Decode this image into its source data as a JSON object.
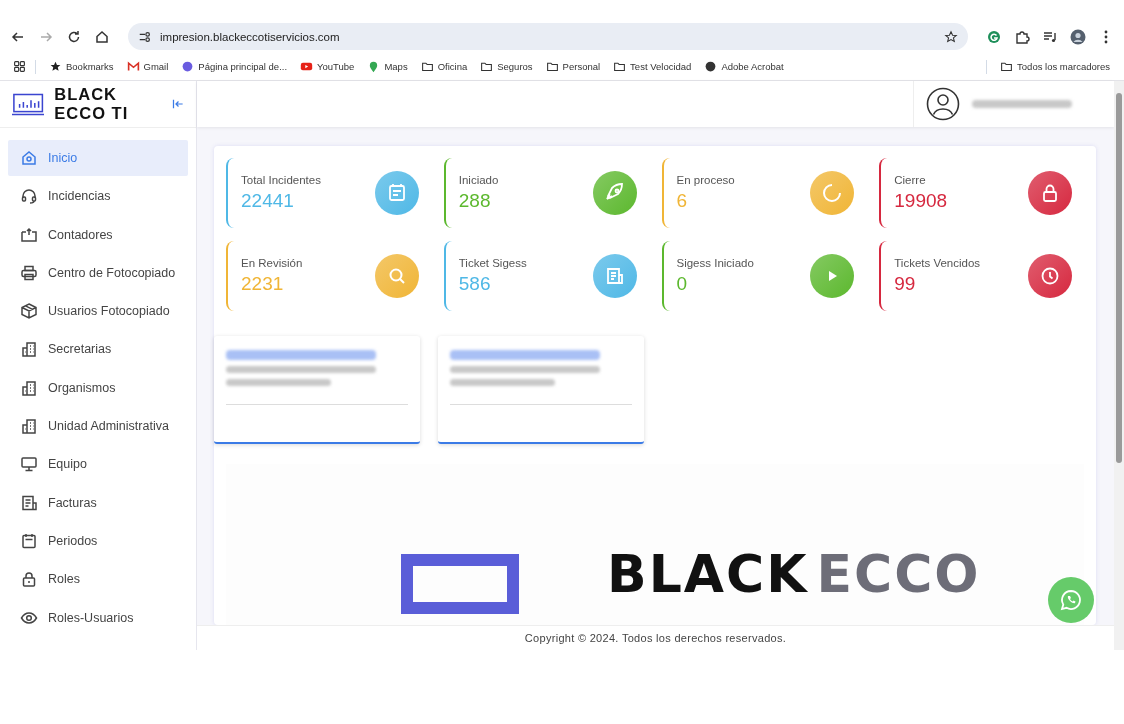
{
  "browser": {
    "url": "impresion.blackeccotiservicios.com",
    "bookmarks": [
      {
        "kind": "star",
        "label": "Bookmarks"
      },
      {
        "kind": "mail",
        "label": "Gmail"
      },
      {
        "kind": "edge",
        "label": "Página principal de..."
      },
      {
        "kind": "video",
        "label": "YouTube"
      },
      {
        "kind": "pin",
        "label": "Maps"
      },
      {
        "kind": "folder",
        "label": "Oficina"
      },
      {
        "kind": "folder",
        "label": "Seguros"
      },
      {
        "kind": "folder",
        "label": "Personal"
      },
      {
        "kind": "folder",
        "label": "Test Velocidad"
      },
      {
        "kind": "globe",
        "label": "Adobe Acrobat"
      }
    ],
    "all_bookmarks": "Todos los marcadores"
  },
  "sidebar": {
    "brand": "BLACK ECCO TI",
    "items": [
      {
        "kind": "home",
        "label": "Inicio",
        "selected": true
      },
      {
        "kind": "headset",
        "label": "Incidencias",
        "selected": false
      },
      {
        "kind": "counter",
        "label": "Contadores",
        "selected": false
      },
      {
        "kind": "printer",
        "label": "Centro de Fotocopiado",
        "selected": false
      },
      {
        "kind": "box",
        "label": "Usuarios Fotocopiado",
        "selected": false
      },
      {
        "kind": "building",
        "label": "Secretarias",
        "selected": false
      },
      {
        "kind": "building",
        "label": "Organismos",
        "selected": false
      },
      {
        "kind": "building",
        "label": "Unidad Administrativa",
        "selected": false
      },
      {
        "kind": "monitor",
        "label": "Equipo",
        "selected": false
      },
      {
        "kind": "invoice",
        "label": "Facturas",
        "selected": false
      },
      {
        "kind": "calendar",
        "label": "Periodos",
        "selected": false
      },
      {
        "kind": "lock",
        "label": "Roles",
        "selected": false
      },
      {
        "kind": "eye",
        "label": "Roles-Usuarios",
        "selected": false
      }
    ]
  },
  "stats": [
    {
      "label": "Total Incidentes",
      "value": "22441",
      "color": "#4fb8e6",
      "kind": "calendar"
    },
    {
      "label": "Iniciado",
      "value": "288",
      "color": "#5cb82e",
      "kind": "rocket"
    },
    {
      "label": "En proceso",
      "value": "6",
      "color": "#f0b536",
      "kind": "spinner"
    },
    {
      "label": "Cierre",
      "value": "19908",
      "color": "#d6283f",
      "kind": "lock"
    },
    {
      "label": "En Revisión",
      "value": "2231",
      "color": "#f0b536",
      "kind": "search"
    },
    {
      "label": "Ticket Sigess",
      "value": "586",
      "color": "#4fb8e6",
      "kind": "news"
    },
    {
      "label": "Sigess Iniciado",
      "value": "0",
      "color": "#5cb82e",
      "kind": "play"
    },
    {
      "label": "Tickets Vencidos",
      "value": "99",
      "color": "#d6283f",
      "kind": "clock"
    }
  ],
  "banner": {
    "word_1": "BLACK",
    "word_2": "ECCO"
  },
  "footer": "Copyright © 2024. Todos los derechos reservados."
}
